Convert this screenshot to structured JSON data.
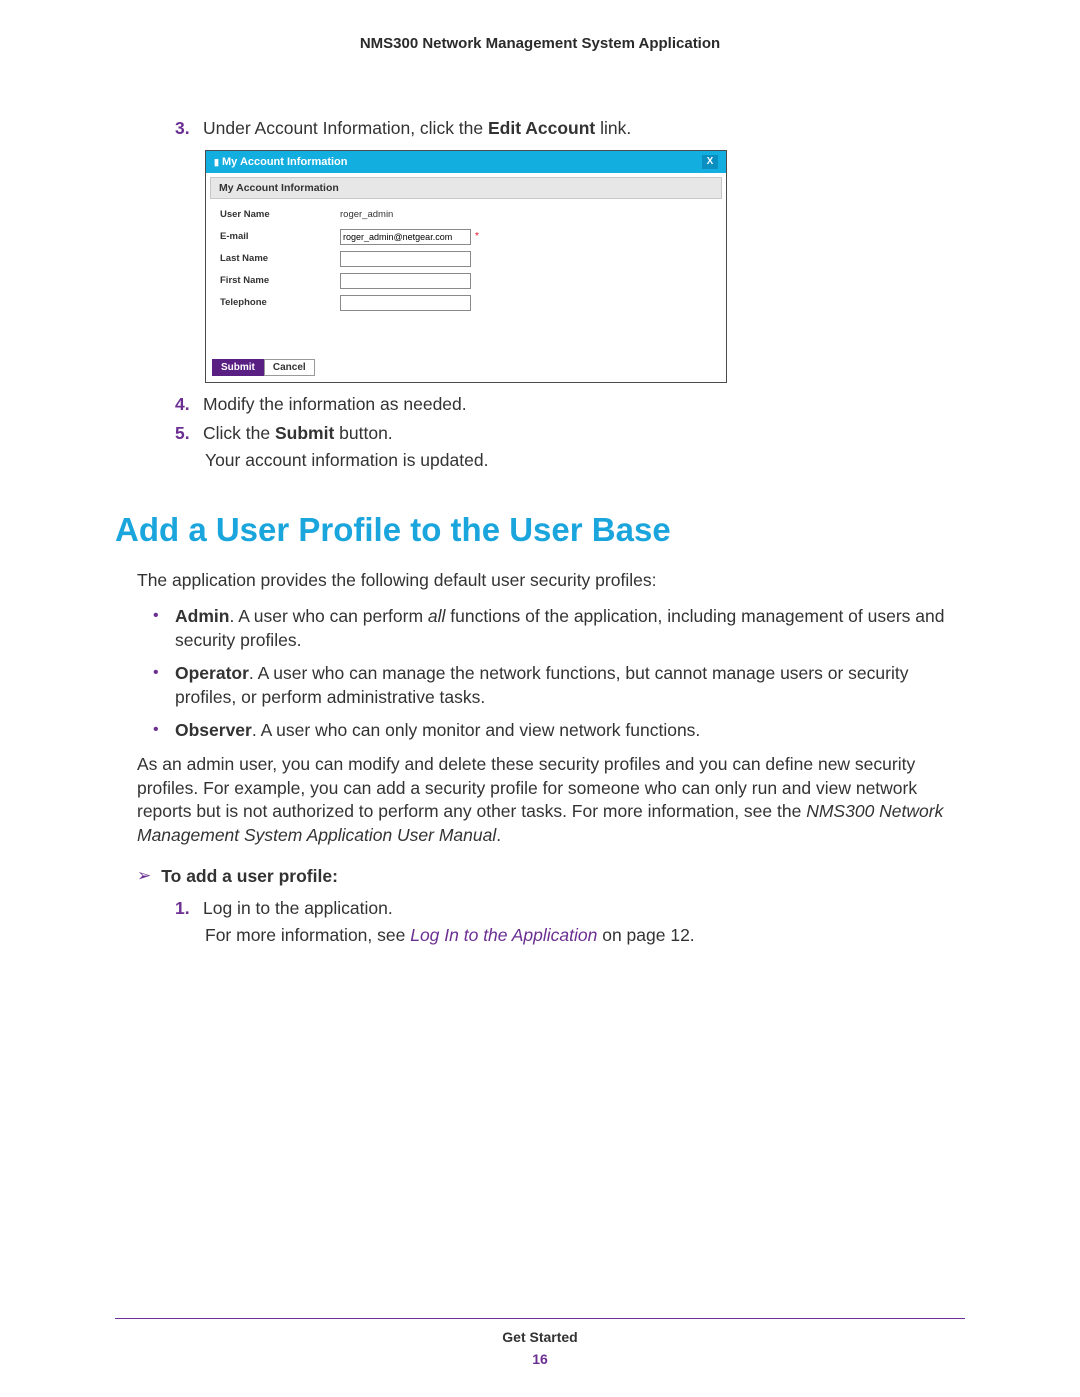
{
  "header": {
    "title": "NMS300 Network Management System Application"
  },
  "steps_a": {
    "3": {
      "num": "3.",
      "pre": "Under Account Information, click the ",
      "bold": "Edit Account",
      "post": " link."
    },
    "4": {
      "num": "4.",
      "text": "Modify the information as needed."
    },
    "5": {
      "num": "5.",
      "pre": "Click the ",
      "bold": "Submit",
      "post": " button."
    },
    "after5": "Your account information is updated."
  },
  "shot": {
    "title": "My Account Information",
    "close": "X",
    "section": "My Account Information",
    "labels": {
      "user": "User Name",
      "email": "E-mail",
      "last": "Last Name",
      "first": "First Name",
      "tel": "Telephone"
    },
    "values": {
      "user": "roger_admin",
      "email": "roger_admin@netgear.com"
    },
    "required_mark": "*",
    "buttons": {
      "submit": "Submit",
      "cancel": "Cancel"
    }
  },
  "section_title": "Add a User Profile to the User Base",
  "intro": "The application provides the following default user security profiles:",
  "profiles": {
    "admin": {
      "name": "Admin",
      "txt_a": ". A user who can perform ",
      "txt_all": "all",
      "txt_b": " functions of the application, including management of users and security profiles."
    },
    "operator": {
      "name": "Operator",
      "txt": ". A user who can manage the network functions, but cannot manage users or security profiles, or perform administrative tasks."
    },
    "observer": {
      "name": "Observer",
      "txt": ". A user who can only monitor and view network functions."
    }
  },
  "para2_a": "As an admin user, you can modify and delete these security profiles and you can define new security profiles. For example, you can add a security profile for someone who can only run and view network reports but is not authorized to perform any other tasks. For more information, see the ",
  "para2_doc": "NMS300 Network Management System Application User Manual",
  "para2_b": ".",
  "procedure": {
    "heading": "To add a user profile:",
    "1": {
      "num": "1.",
      "text": "Log in to the application."
    },
    "after1_a": "For more information, see ",
    "after1_link": "Log In to the Application",
    "after1_b": " on page 12."
  },
  "footer": {
    "label": "Get Started",
    "page": "16"
  }
}
